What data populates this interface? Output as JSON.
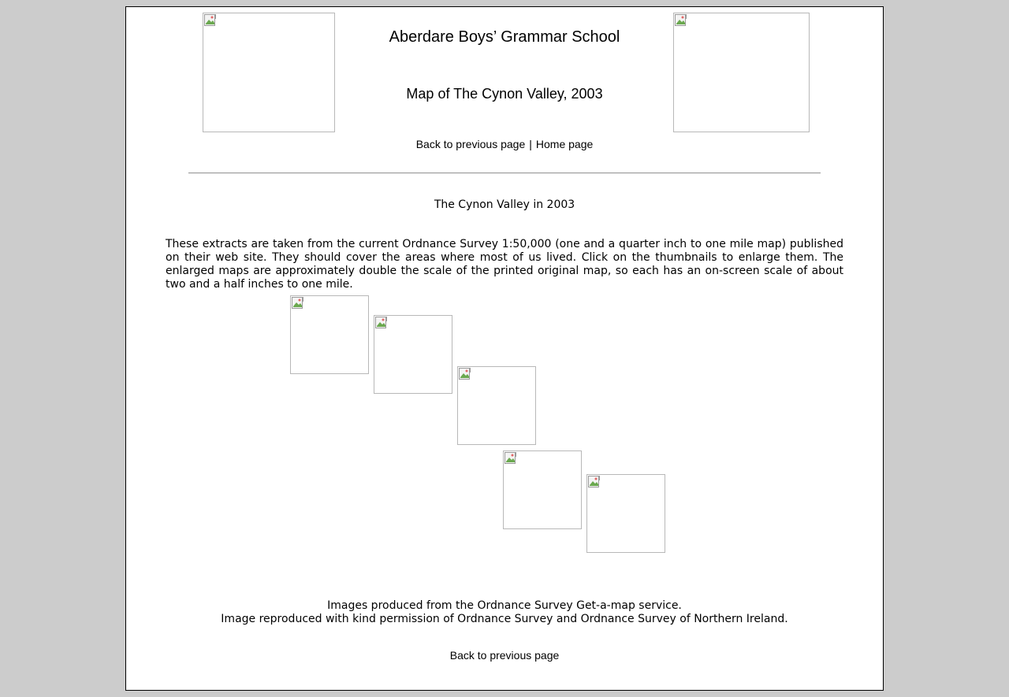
{
  "header": {
    "title": "Aberdare Boys’ Grammar School",
    "subtitle": "Map of The Cynon Valley, 2003"
  },
  "nav_top": {
    "back_label": "Back to previous page",
    "separator": "|",
    "home_label": "Home page"
  },
  "content": {
    "heading": "The Cynon Valley in 2003",
    "intro": "These extracts are taken from the current Ordnance Survey 1:50,000 (one and a quarter inch to one mile map) published on their web site. They should cover the areas where most of us lived. Click on the thumbnails to enlarge them. The enlarged maps are approximately double the scale of the printed original map, so each has an on-screen scale of about two and a half inches to one mile."
  },
  "footer": {
    "credit_line_1": "Images produced from the Ordnance Survey Get-a-map service.",
    "credit_line_2": "Image reproduced with kind permission of Ordnance Survey and Ordnance Survey of Northern Ireland.",
    "back_label": "Back to previous page"
  },
  "colors": {
    "page_background": "#cccccc",
    "content_background": "#ffffff",
    "image_border": "#b8b8b8"
  },
  "icons": {
    "broken_image": "broken-image-icon"
  }
}
